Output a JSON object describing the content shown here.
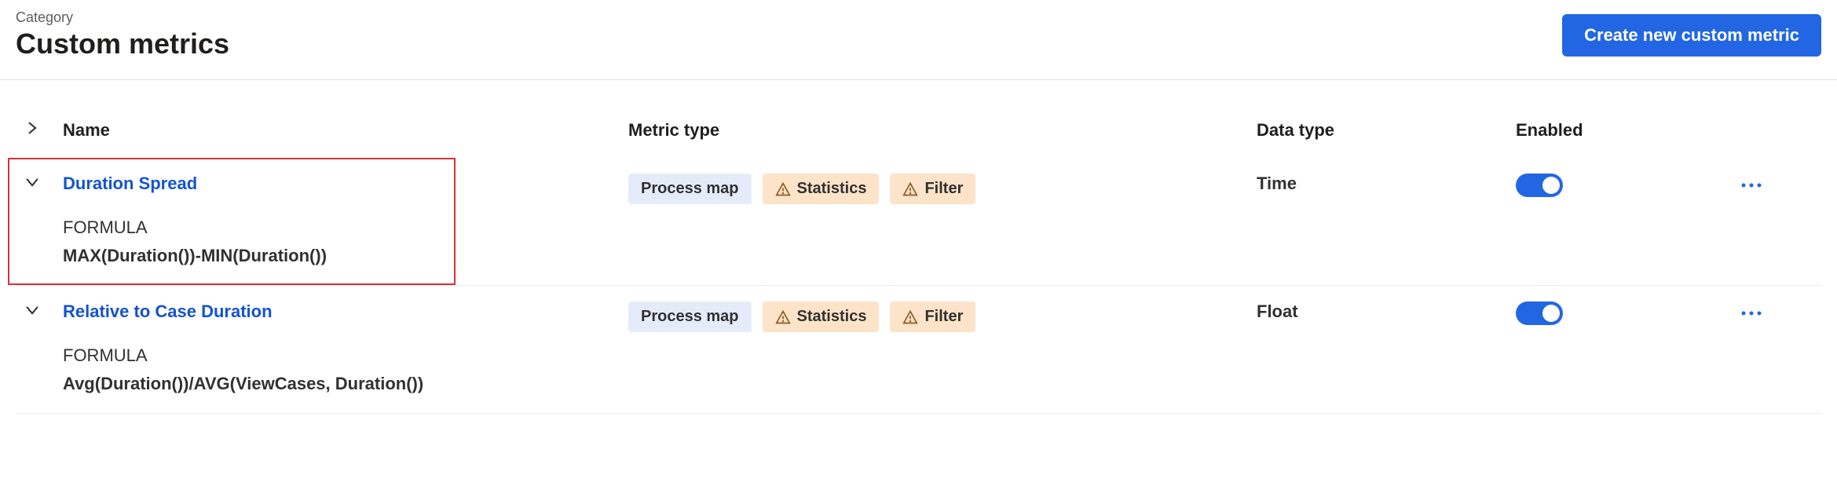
{
  "header": {
    "category_label": "Category",
    "page_title": "Custom metrics",
    "create_button": "Create new custom metric"
  },
  "columns": {
    "name": "Name",
    "metric_type": "Metric type",
    "data_type": "Data type",
    "enabled": "Enabled"
  },
  "rows": [
    {
      "name": "Duration Spread",
      "formula_label": "FORMULA",
      "formula": "MAX(Duration())-MIN(Duration())",
      "badges": {
        "process": "Process map",
        "statistics": "Statistics",
        "filter": "Filter"
      },
      "data_type": "Time",
      "enabled": true,
      "highlighted": true
    },
    {
      "name": "Relative to Case Duration",
      "formula_label": "FORMULA",
      "formula": "Avg(Duration())/AVG(ViewCases, Duration())",
      "badges": {
        "process": "Process map",
        "statistics": "Statistics",
        "filter": "Filter"
      },
      "data_type": "Float",
      "enabled": true,
      "highlighted": false
    }
  ]
}
